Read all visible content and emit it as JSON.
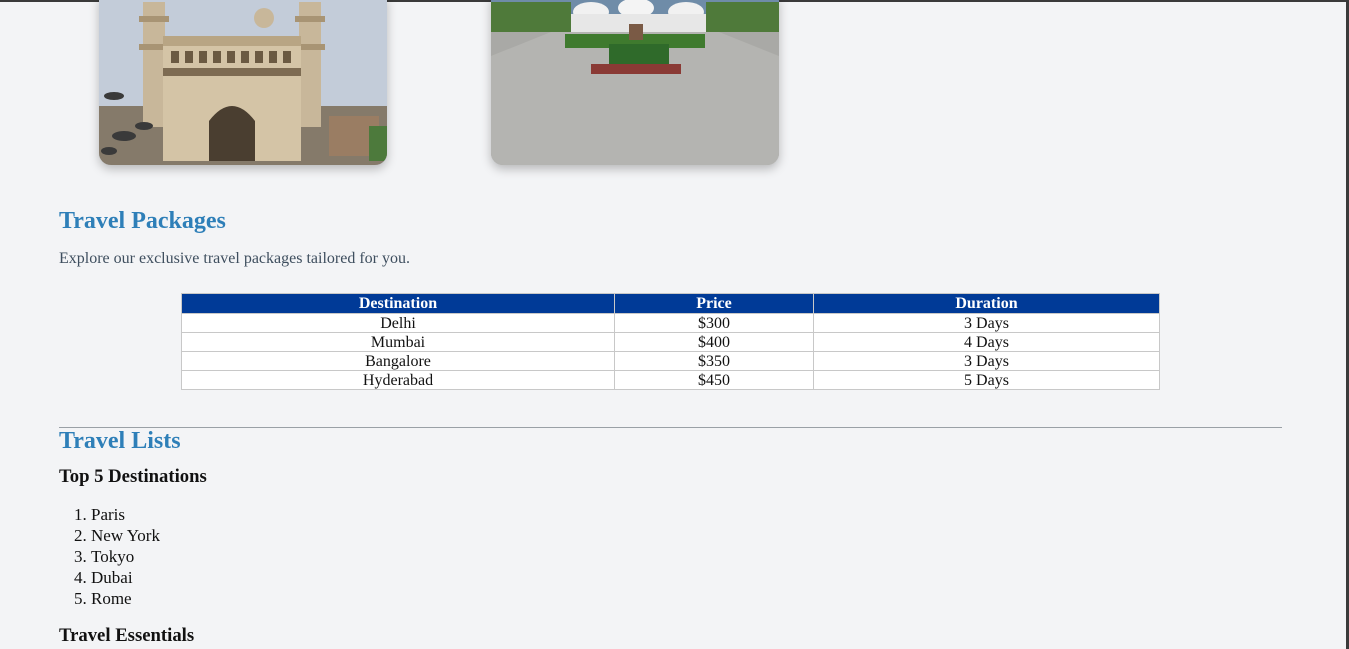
{
  "images": [
    {
      "name": "charminar-photo",
      "alt": "Charminar, Hyderabad"
    },
    {
      "name": "memorial-photo",
      "alt": "Memorial park with white domed structures"
    }
  ],
  "packages": {
    "title": "Travel Packages",
    "description": "Explore our exclusive travel packages tailored for you.",
    "headers": [
      "Destination",
      "Price",
      "Duration"
    ],
    "rows": [
      [
        "Delhi",
        "$300",
        "3 Days"
      ],
      [
        "Mumbai",
        "$400",
        "4 Days"
      ],
      [
        "Bangalore",
        "$350",
        "3 Days"
      ],
      [
        "Hyderabad",
        "$450",
        "5 Days"
      ]
    ],
    "header_color": "#003a97"
  },
  "lists": {
    "title": "Travel Lists",
    "top5_title": "Top 5 Destinations",
    "top5": [
      "Paris",
      "New York",
      "Tokyo",
      "Dubai",
      "Rome"
    ],
    "essentials_title": "Travel Essentials"
  },
  "colors": {
    "heading": "#2e7fb8",
    "background": "#f3f4f6"
  }
}
